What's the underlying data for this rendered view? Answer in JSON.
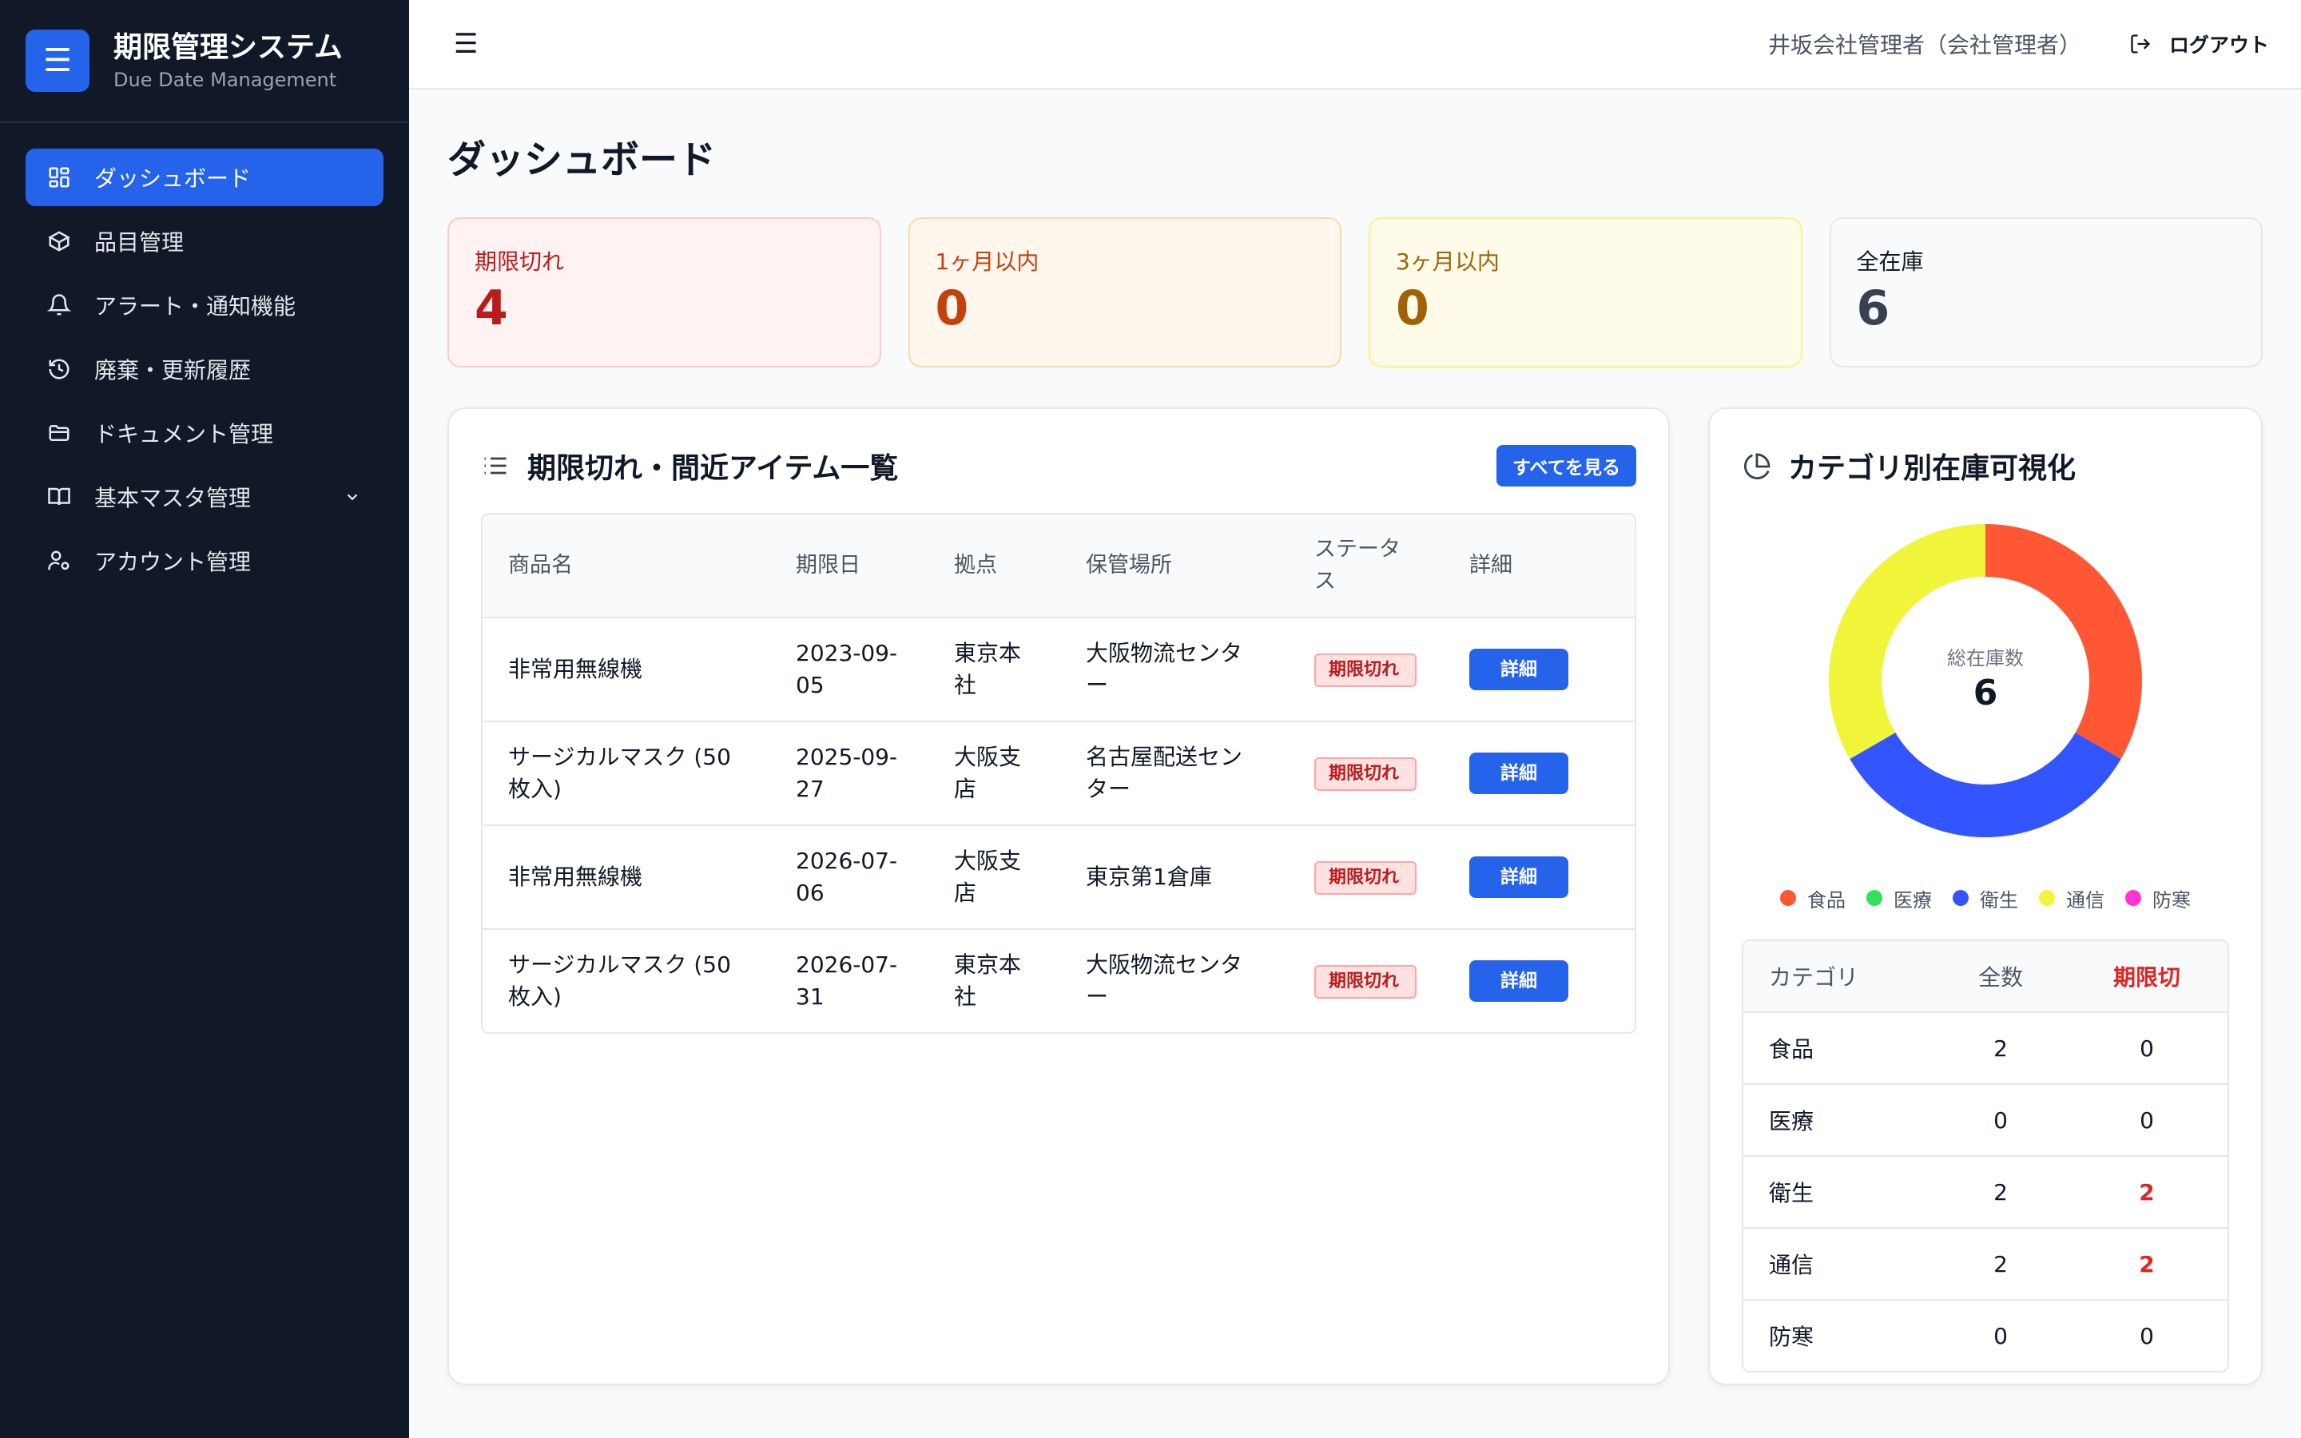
{
  "brand": {
    "title": "期限管理システム",
    "subtitle": "Due Date Management",
    "logo_icon": "menu-icon"
  },
  "sidebar": {
    "items": [
      {
        "label": "ダッシュボード",
        "icon": "dashboard-grid-icon",
        "active": true
      },
      {
        "label": "品目管理",
        "icon": "box-icon",
        "active": false
      },
      {
        "label": "アラート・通知機能",
        "icon": "bell-icon",
        "active": false
      },
      {
        "label": "廃棄・更新履歴",
        "icon": "history-icon",
        "active": false
      },
      {
        "label": "ドキュメント管理",
        "icon": "folder-icon",
        "active": false
      },
      {
        "label": "基本マスタ管理",
        "icon": "book-icon",
        "active": false,
        "expandable": true
      },
      {
        "label": "アカウント管理",
        "icon": "user-cog-icon",
        "active": false
      }
    ]
  },
  "header": {
    "menu_icon": "☰",
    "user": "井坂会社管理者（会社管理者）",
    "logout": "ログアウト"
  },
  "page": {
    "title": "ダッシュボード"
  },
  "stats": [
    {
      "label": "期限切れ",
      "value": "4",
      "tone": "red"
    },
    {
      "label": "1ヶ月以内",
      "value": "0",
      "tone": "orange"
    },
    {
      "label": "3ヶ月以内",
      "value": "0",
      "tone": "yellow"
    },
    {
      "label": "全在庫",
      "value": "6",
      "tone": "gray"
    }
  ],
  "items_panel": {
    "title": "期限切れ・間近アイテム一覧",
    "see_all": "すべてを見る",
    "columns": [
      "商品名",
      "期限日",
      "拠点",
      "保管場所",
      "ステータス",
      "詳細"
    ],
    "rows": [
      {
        "name": "非常用無線機",
        "date": "2023-09-05",
        "site": "東京本社",
        "location": "大阪物流センター",
        "status": "期限切れ",
        "detail": "詳細"
      },
      {
        "name": "サージカルマスク (50枚入)",
        "date": "2025-09-27",
        "site": "大阪支店",
        "location": "名古屋配送センター",
        "status": "期限切れ",
        "detail": "詳細"
      },
      {
        "name": "非常用無線機",
        "date": "2026-07-06",
        "site": "大阪支店",
        "location": "東京第1倉庫",
        "status": "期限切れ",
        "detail": "詳細"
      },
      {
        "name": "サージカルマスク (50枚入)",
        "date": "2026-07-31",
        "site": "東京本社",
        "location": "大阪物流センター",
        "status": "期限切れ",
        "detail": "詳細"
      }
    ]
  },
  "category_panel": {
    "title": "カテゴリ別在庫可視化",
    "center_label": "総在庫数",
    "center_value": "6",
    "columns": [
      "カテゴリ",
      "全数",
      "期限切"
    ],
    "rows": [
      {
        "category": "食品",
        "total": "2",
        "expired": "0"
      },
      {
        "category": "医療",
        "total": "0",
        "expired": "0"
      },
      {
        "category": "衛生",
        "total": "2",
        "expired": "2"
      },
      {
        "category": "通信",
        "total": "2",
        "expired": "2"
      },
      {
        "category": "防寒",
        "total": "0",
        "expired": "0"
      }
    ]
  },
  "chart_data": {
    "type": "pie",
    "categories": [
      "食品",
      "医療",
      "衛生",
      "通信",
      "防寒"
    ],
    "values": [
      2,
      0,
      2,
      2,
      0
    ],
    "colors": [
      "#ff5733",
      "#33e05a",
      "#3355ff",
      "#f0f53a",
      "#ff33d6"
    ],
    "legend": "bottom"
  }
}
